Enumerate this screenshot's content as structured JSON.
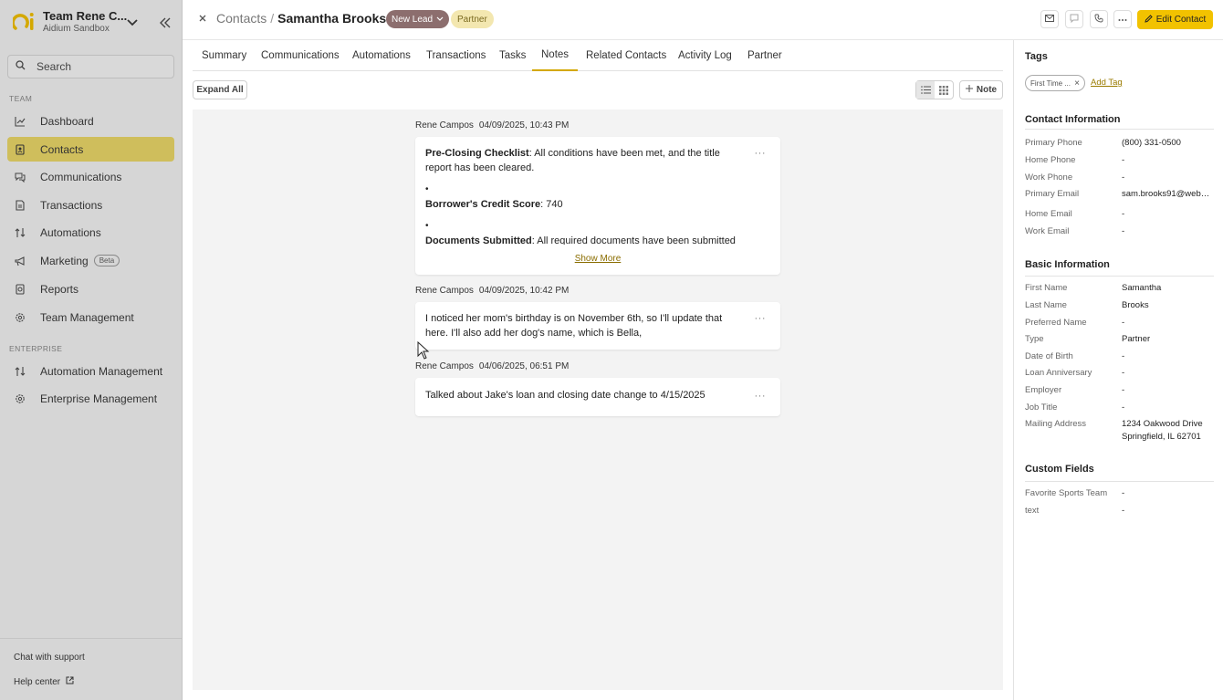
{
  "sidebar": {
    "org_name": "Team Rene C...",
    "org_sub": "Aidium Sandbox",
    "search_placeholder": "Search",
    "team_label": "TEAM",
    "enterprise_label": "ENTERPRISE",
    "items": [
      {
        "label": "Dashboard",
        "icon": "chart-line-icon"
      },
      {
        "label": "Contacts",
        "icon": "contact-book-icon",
        "active": true
      },
      {
        "label": "Communications",
        "icon": "chat-bubbles-icon"
      },
      {
        "label": "Transactions",
        "icon": "document-icon"
      },
      {
        "label": "Automations",
        "icon": "automation-arrows-icon"
      },
      {
        "label": "Marketing",
        "icon": "megaphone-icon",
        "badge": "Beta"
      },
      {
        "label": "Reports",
        "icon": "report-icon"
      },
      {
        "label": "Team Management",
        "icon": "gear-icon"
      }
    ],
    "enterprise_items": [
      {
        "label": "Automation Management",
        "icon": "automation-arrows-icon"
      },
      {
        "label": "Enterprise Management",
        "icon": "gear-icon"
      }
    ],
    "chat_support": "Chat with support",
    "help_center": "Help center"
  },
  "header": {
    "crumb_root": "Contacts",
    "crumb_sep": "/",
    "contact_name": "Samantha Brooks",
    "status_badge": "New Lead",
    "type_badge": "Partner",
    "edit_label": "Edit Contact"
  },
  "tabs": [
    "Summary",
    "Communications",
    "Automations",
    "Transactions",
    "Tasks",
    "Notes",
    "Related Contacts",
    "Activity Log",
    "Partner"
  ],
  "active_tab": "Notes",
  "toolbar": {
    "expand_all": "Expand All",
    "add_note": "Note"
  },
  "notes": [
    {
      "author": "Rene Campos",
      "timestamp": "04/09/2025, 10:43 PM",
      "p1_bold": "Pre-Closing Checklist",
      "p1_text": ": All conditions have been met, and the title report has been cleared.",
      "b1_bold": "Borrower's Credit Score",
      "b1_text": ": 740",
      "b2_bold": "Documents Submitted",
      "b2_text": ": All required documents have been submitted and",
      "show_more": "Show More"
    },
    {
      "author": "Rene Campos",
      "timestamp": "04/09/2025, 10:42 PM",
      "text": "I noticed her mom's birthday is on November 6th, so I'll update that here. I'll also add her dog's name, which is Bella,"
    },
    {
      "author": "Rene Campos",
      "timestamp": "04/06/2025, 06:51 PM",
      "text": "Talked about Jake's loan and closing date change to 4/15/2025"
    }
  ],
  "right_panel": {
    "tags_title": "Tags",
    "tag_chip": "First Time ...",
    "add_tag": "Add Tag",
    "contact_title": "Contact Information",
    "contact_fields": [
      {
        "label": "Primary Phone",
        "value": "(800) 331-0500"
      },
      {
        "label": "Home Phone",
        "value": "-"
      },
      {
        "label": "Work Phone",
        "value": "-"
      },
      {
        "label": "Primary Email",
        "value": "sam.brooks91@webm..."
      },
      {
        "label": "Home Email",
        "value": "-"
      },
      {
        "label": "Work Email",
        "value": "-"
      }
    ],
    "basic_title": "Basic Information",
    "basic_fields": [
      {
        "label": "First Name",
        "value": "Samantha"
      },
      {
        "label": "Last Name",
        "value": "Brooks"
      },
      {
        "label": "Preferred Name",
        "value": "-"
      },
      {
        "label": "Type",
        "value": "Partner"
      },
      {
        "label": "Date of Birth",
        "value": "-"
      },
      {
        "label": "Loan Anniversary",
        "value": "-"
      },
      {
        "label": "Employer",
        "value": "-"
      },
      {
        "label": "Job Title",
        "value": "-"
      },
      {
        "label": "Mailing Address",
        "value": "1234 Oakwood Drive",
        "value2": "Springfield, IL 62701"
      }
    ],
    "custom_title": "Custom Fields",
    "custom_fields": [
      {
        "label": "Favorite Sports Team",
        "value": "-"
      },
      {
        "label": "text",
        "value": "-"
      }
    ]
  },
  "colors": {
    "accent": "#f2c200",
    "active_nav": "#cfbe5c",
    "status_badge": "#8c6e6e",
    "partner_badge": "#f3e7b0"
  }
}
